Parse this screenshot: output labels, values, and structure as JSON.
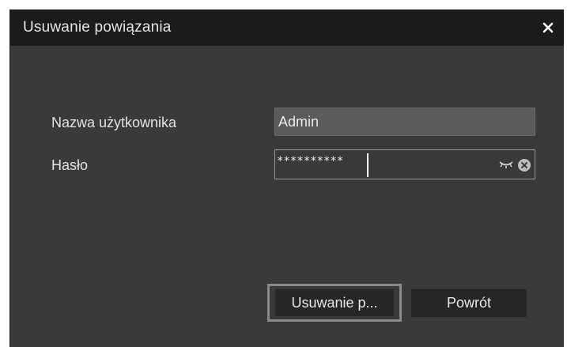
{
  "dialog": {
    "title": "Usuwanie powiązania",
    "close_icon": "close-icon"
  },
  "form": {
    "username_label": "Nazwa użytkownika",
    "username_value": "Admin",
    "password_label": "Hasło",
    "password_value": "**********",
    "show_password_icon": "eye-closed-icon",
    "clear_icon": "clear-circle-icon"
  },
  "buttons": {
    "delete_label": "Usuwanie p...",
    "back_label": "Powrót"
  },
  "colors": {
    "titlebar": "#1b1b1b",
    "dialog_bg": "#3a3a3a",
    "input_bg": "#5b5b5b",
    "button_bg": "#262626",
    "focus_border": "#8a8a8a"
  }
}
